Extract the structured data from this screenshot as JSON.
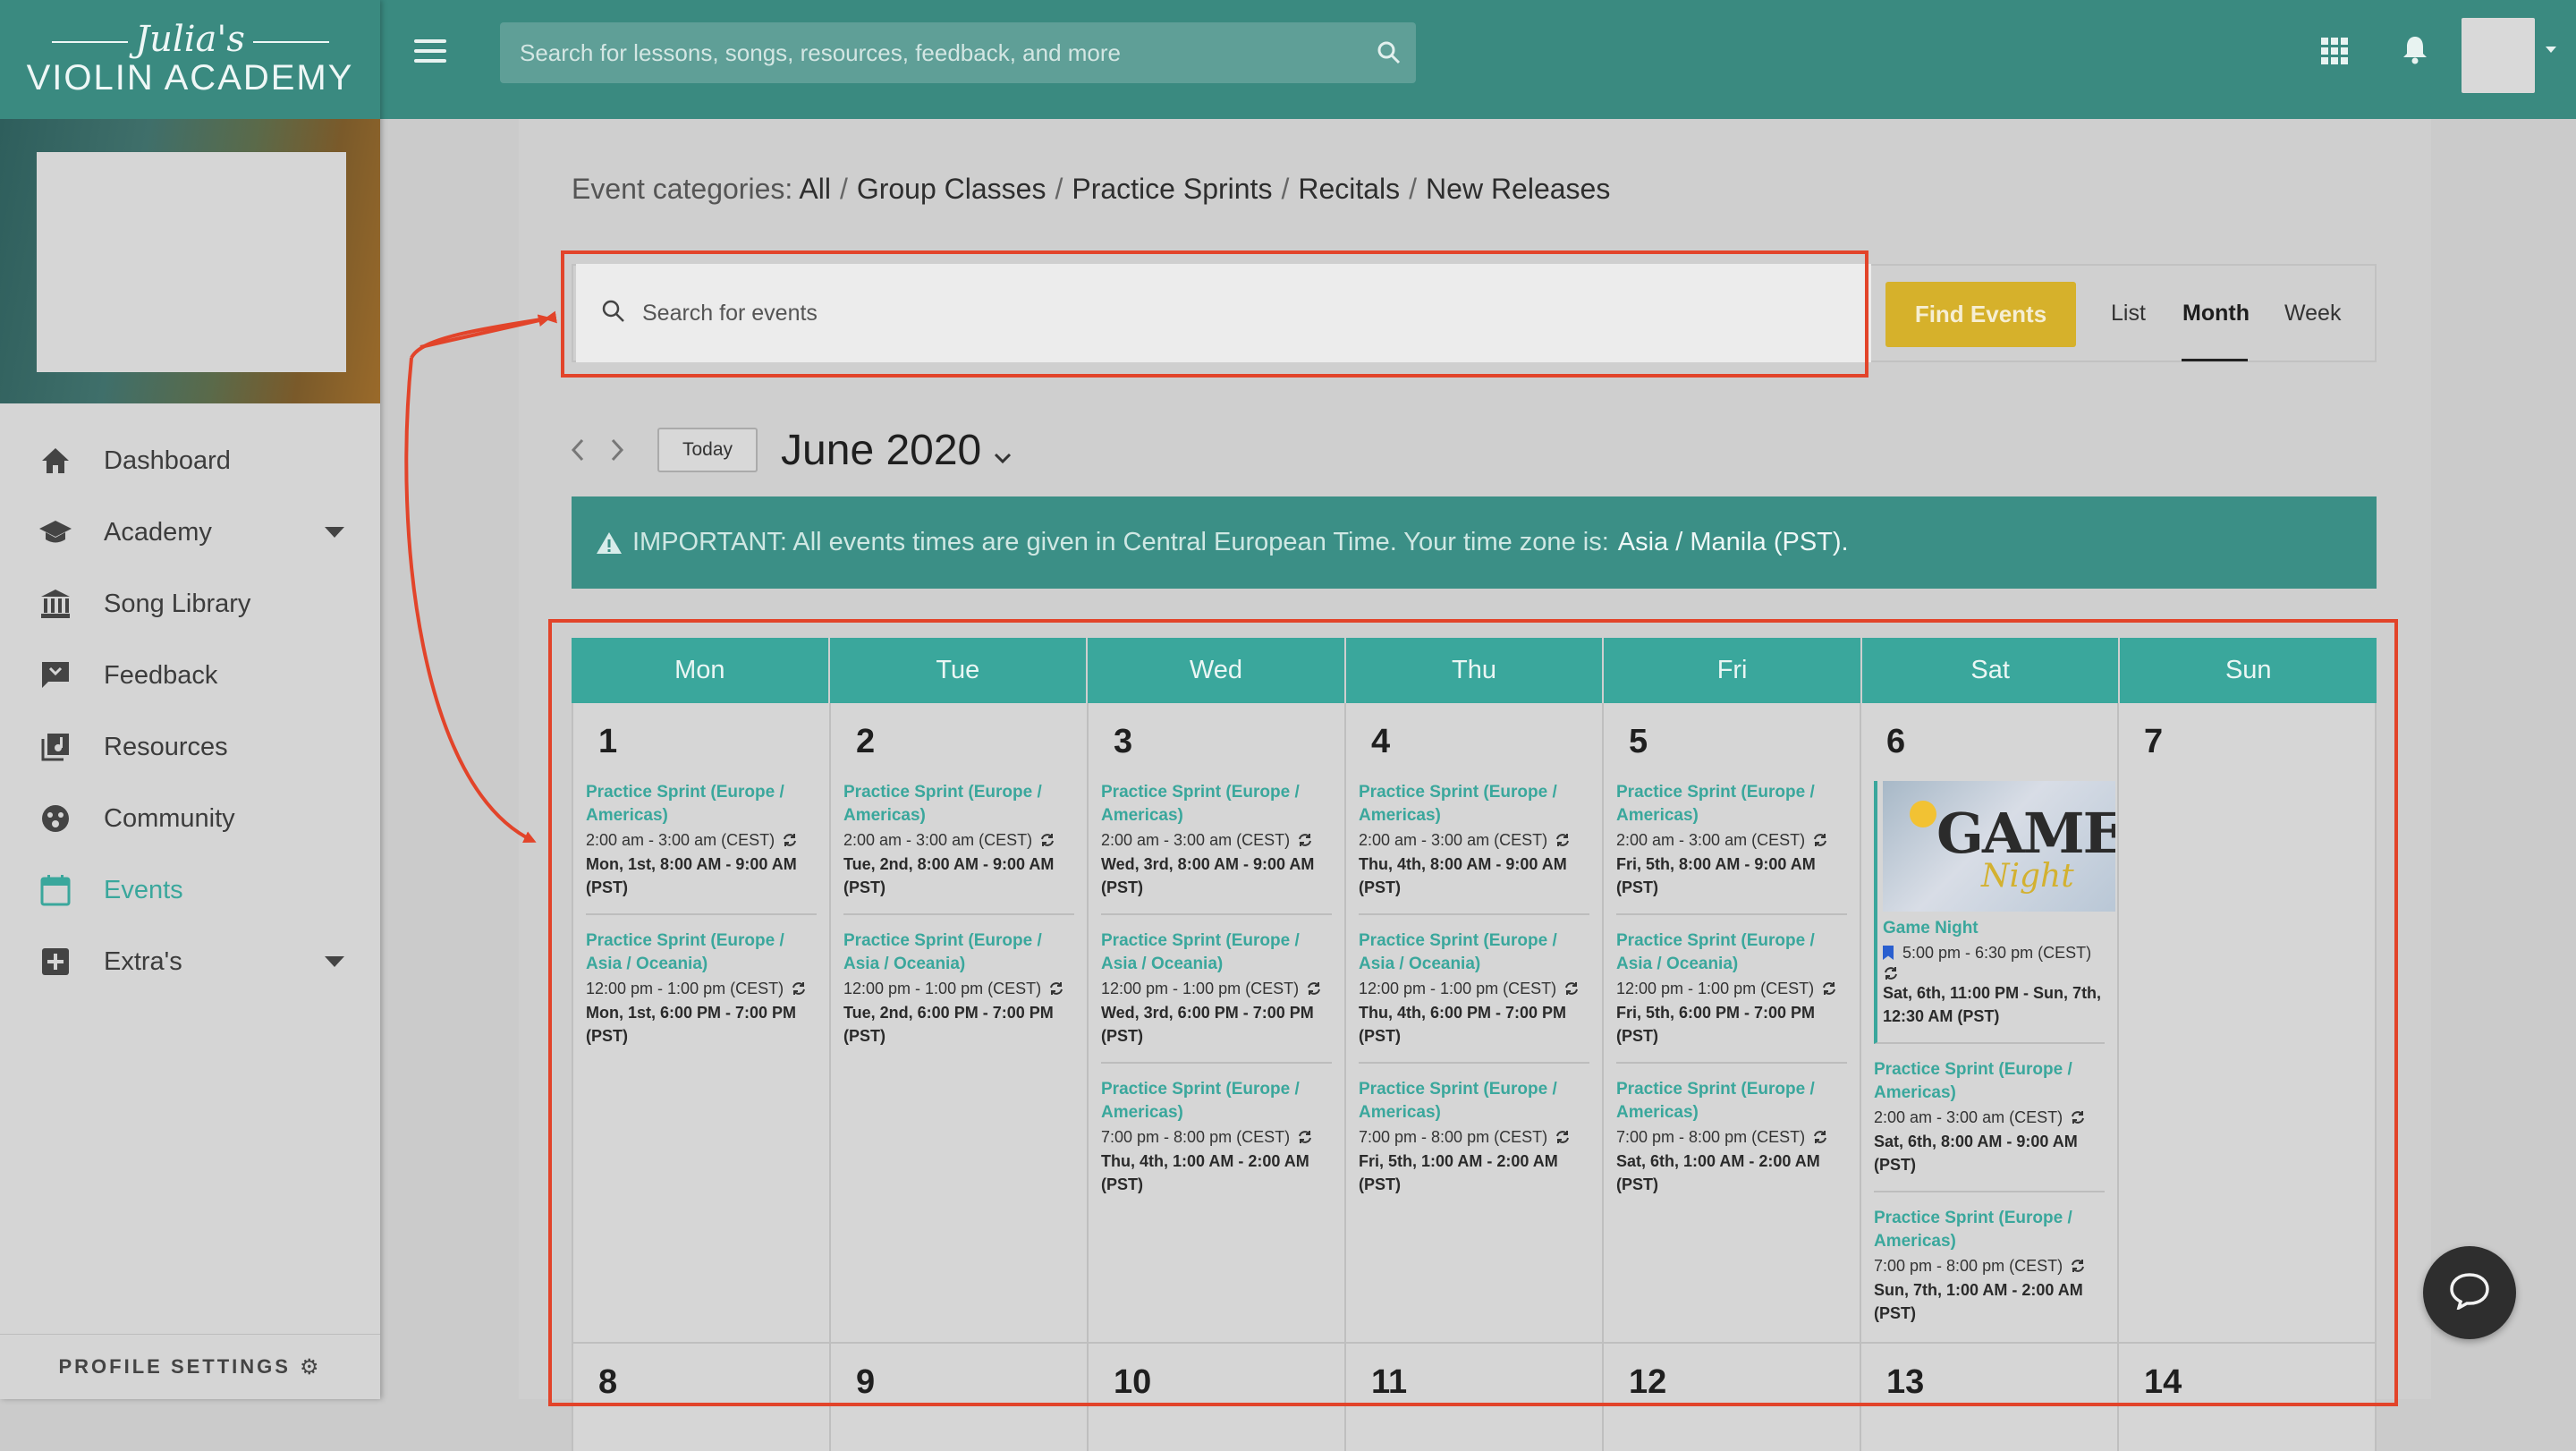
{
  "brand": {
    "script": "Julia's",
    "name": "VIOLIN ACADEMY"
  },
  "header": {
    "search_placeholder": "Search for lessons, songs, resources, feedback, and more"
  },
  "sidebar": {
    "items": [
      {
        "label": "Dashboard",
        "icon": "home-icon"
      },
      {
        "label": "Academy",
        "icon": "graduation-cap-icon"
      },
      {
        "label": "Song Library",
        "icon": "library-icon"
      },
      {
        "label": "Feedback",
        "icon": "feedback-icon"
      },
      {
        "label": "Resources",
        "icon": "resources-icon"
      },
      {
        "label": "Community",
        "icon": "community-icon"
      },
      {
        "label": "Events",
        "icon": "calendar-icon"
      },
      {
        "label": "Extra's",
        "icon": "plus-box-icon"
      }
    ],
    "active": "Events",
    "profile_settings": "PROFILE SETTINGS"
  },
  "categories": {
    "label": "Event categories:",
    "items": [
      "All",
      "Group Classes",
      "Practice Sprints",
      "Recitals",
      "New Releases"
    ]
  },
  "filter": {
    "search_placeholder": "Search for events",
    "find_button": "Find Events",
    "views": [
      "List",
      "Month",
      "Week"
    ],
    "active_view": "Month"
  },
  "nav": {
    "today": "Today",
    "month": "June 2020"
  },
  "notice": {
    "text": "IMPORTANT: All events times are given in Central European Time. Your time zone is:",
    "timezone": "Asia / Manila (PST)."
  },
  "calendar": {
    "weekdays": [
      "Mon",
      "Tue",
      "Wed",
      "Thu",
      "Fri",
      "Sat",
      "Sun"
    ],
    "week1": [
      {
        "day": "1",
        "events": [
          {
            "title": "Practice Sprint (Europe / Americas)",
            "time": "2:00 am - 3:00 am (CEST)",
            "local": "Mon, 1st, 8:00 AM - 9:00 AM (PST)"
          },
          {
            "title": "Practice Sprint (Europe / Asia / Oceania)",
            "time": "12:00 pm - 1:00 pm (CEST)",
            "local": "Mon, 1st, 6:00 PM - 7:00 PM (PST)"
          }
        ]
      },
      {
        "day": "2",
        "events": [
          {
            "title": "Practice Sprint (Europe / Americas)",
            "time": "2:00 am - 3:00 am (CEST)",
            "local": "Tue, 2nd, 8:00 AM - 9:00 AM (PST)"
          },
          {
            "title": "Practice Sprint (Europe / Asia / Oceania)",
            "time": "12:00 pm - 1:00 pm (CEST)",
            "local": "Tue, 2nd, 6:00 PM - 7:00 PM (PST)"
          }
        ]
      },
      {
        "day": "3",
        "events": [
          {
            "title": "Practice Sprint (Europe / Americas)",
            "time": "2:00 am - 3:00 am (CEST)",
            "local": "Wed, 3rd, 8:00 AM - 9:00 AM (PST)"
          },
          {
            "title": "Practice Sprint (Europe / Asia / Oceania)",
            "time": "12:00 pm - 1:00 pm (CEST)",
            "local": "Wed, 3rd, 6:00 PM - 7:00 PM (PST)"
          },
          {
            "title": "Practice Sprint (Europe / Americas)",
            "time": "7:00 pm - 8:00 pm (CEST)",
            "local": "Thu, 4th, 1:00 AM - 2:00 AM (PST)"
          }
        ]
      },
      {
        "day": "4",
        "events": [
          {
            "title": "Practice Sprint (Europe / Americas)",
            "time": "2:00 am - 3:00 am (CEST)",
            "local": "Thu, 4th, 8:00 AM - 9:00 AM (PST)"
          },
          {
            "title": "Practice Sprint (Europe / Asia / Oceania)",
            "time": "12:00 pm - 1:00 pm (CEST)",
            "local": "Thu, 4th, 6:00 PM - 7:00 PM (PST)"
          },
          {
            "title": "Practice Sprint (Europe / Americas)",
            "time": "7:00 pm - 8:00 pm (CEST)",
            "local": "Fri, 5th, 1:00 AM - 2:00 AM (PST)"
          }
        ]
      },
      {
        "day": "5",
        "events": [
          {
            "title": "Practice Sprint (Europe / Americas)",
            "time": "2:00 am - 3:00 am (CEST)",
            "local": "Fri, 5th, 8:00 AM - 9:00 AM (PST)"
          },
          {
            "title": "Practice Sprint (Europe / Asia / Oceania)",
            "time": "12:00 pm - 1:00 pm (CEST)",
            "local": "Fri, 5th, 6:00 PM - 7:00 PM (PST)"
          },
          {
            "title": "Practice Sprint (Europe / Americas)",
            "time": "7:00 pm - 8:00 pm (CEST)",
            "local": "Sat, 6th, 1:00 AM - 2:00 AM (PST)"
          }
        ]
      },
      {
        "day": "6",
        "featured": {
          "image_title": "GAME",
          "image_subtitle": "Night",
          "title": "Game Night",
          "time": "5:00 pm - 6:30 pm (CEST)",
          "local": "Sat, 6th, 11:00 PM - Sun, 7th, 12:30 AM (PST)"
        },
        "events": [
          {
            "title": "Practice Sprint (Europe / Americas)",
            "time": "2:00 am - 3:00 am (CEST)",
            "local": "Sat, 6th, 8:00 AM - 9:00 AM (PST)"
          },
          {
            "title": "Practice Sprint (Europe / Americas)",
            "time": "7:00 pm - 8:00 pm (CEST)",
            "local": "Sun, 7th, 1:00 AM - 2:00 AM (PST)"
          }
        ]
      },
      {
        "day": "7",
        "events": []
      }
    ],
    "week2": [
      "8",
      "9",
      "10",
      "11",
      "12",
      "13",
      "14"
    ]
  },
  "colors": {
    "teal": "#3a8a80",
    "accent": "#3aa79c",
    "gold": "#d6b12b",
    "annotation": "#e2442a"
  }
}
